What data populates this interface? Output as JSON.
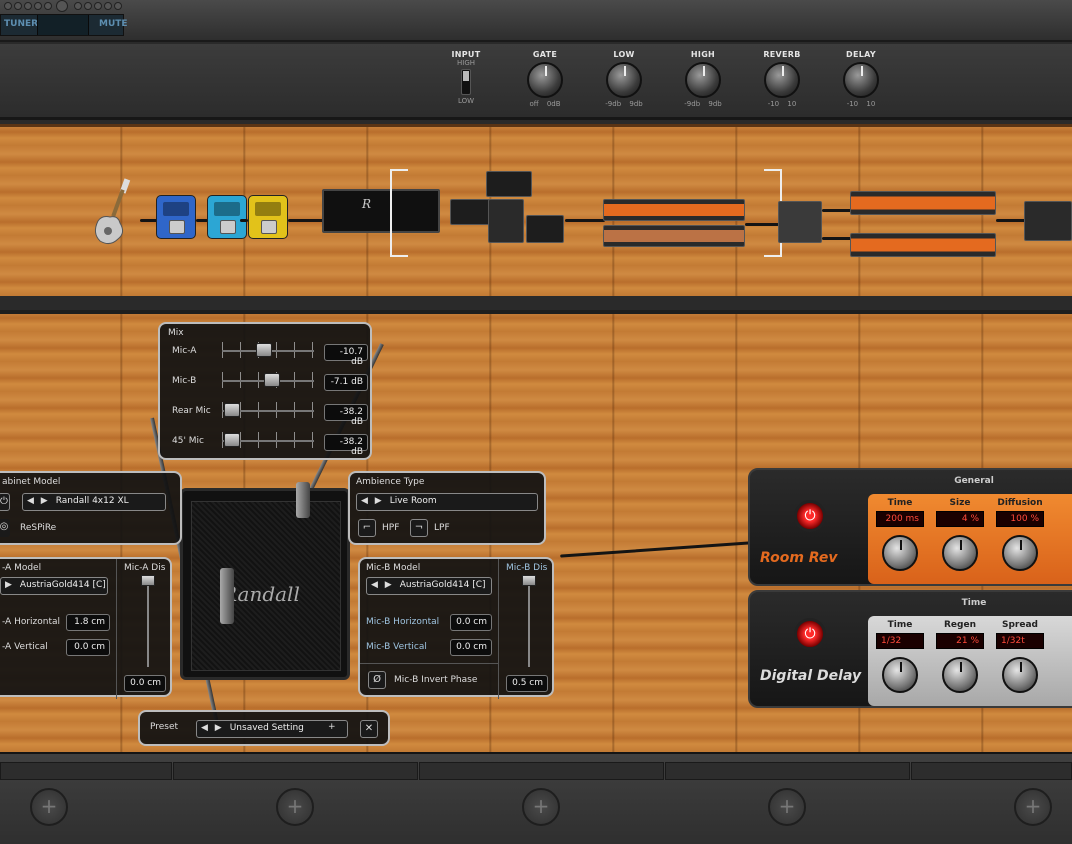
{
  "topbar": {
    "tuner_label": "TUNER",
    "mute_label": "MUTE"
  },
  "input_strip": {
    "input": {
      "label": "INPUT",
      "high": "HIGH",
      "low": "LOW"
    },
    "knobs": [
      {
        "label": "GATE",
        "range": "off 0dB"
      },
      {
        "label": "LOW",
        "range": "-9db 9db"
      },
      {
        "label": "HIGH",
        "range": "-9db 9db"
      },
      {
        "label": "REVERB",
        "range": "-10 10"
      },
      {
        "label": "DELAY",
        "range": "-10 10"
      }
    ]
  },
  "mix": {
    "title": "Mix",
    "rows": [
      {
        "label": "Mic-A",
        "value": "-10.7 dB",
        "level": 0.45
      },
      {
        "label": "Mic-B",
        "value": "-7.1 dB",
        "level": 0.55
      },
      {
        "label": "Rear Mic",
        "value": "-38.2 dB",
        "level": 0.02
      },
      {
        "label": "45' Mic",
        "value": "-38.2 dB",
        "level": 0.02
      }
    ]
  },
  "cabinet": {
    "title": "abinet Model",
    "model": "Randall 4x12 XL",
    "respire": "ReSPiRe",
    "logo": "Randall"
  },
  "ambience": {
    "title": "Ambience Type",
    "value": "Live Room",
    "hpf": "HPF",
    "lpf": "LPF"
  },
  "mic_a": {
    "model_title": "-A Model",
    "model": "AustriaGold414 [C]",
    "dist_title": "Mic-A Dis",
    "horizontal_label": "-A Horizontal",
    "horizontal": "1.8 cm",
    "vertical_label": "-A Vertical",
    "vertical": "0.0 cm",
    "distance": "0.0 cm"
  },
  "mic_b": {
    "model_title": "Mic-B Model",
    "model": "AustriaGold414 [C]",
    "dist_title": "Mic-B Dis",
    "horizontal_label": "Mic-B Horizontal",
    "horizontal": "0.0 cm",
    "vertical_label": "Mic-B Vertical",
    "vertical": "0.0 cm",
    "invert_label": "Mic-B Invert Phase",
    "distance": "0.5 cm"
  },
  "preset": {
    "label": "Preset",
    "value": "Unsaved Setting",
    "plus": "+",
    "close": "✕"
  },
  "room_rev": {
    "name": "Room Rev",
    "section": "General",
    "params": [
      {
        "label": "Time",
        "value": "200 ms"
      },
      {
        "label": "Size",
        "value": "4 %"
      },
      {
        "label": "Diffusion",
        "value": "100 %"
      }
    ]
  },
  "digital_delay": {
    "name": "Digital Delay",
    "section": "Time",
    "params": [
      {
        "label": "Time",
        "value": "1/32"
      },
      {
        "label": "Regen",
        "value": "21 %"
      },
      {
        "label": "Spread",
        "value": "1/32t"
      }
    ]
  },
  "bottom": {
    "add_symbol": "+"
  },
  "colors": {
    "accent_orange": "#e46a1f",
    "led_red": "#ff2a2a",
    "panel_border": "#bdbdbd"
  }
}
